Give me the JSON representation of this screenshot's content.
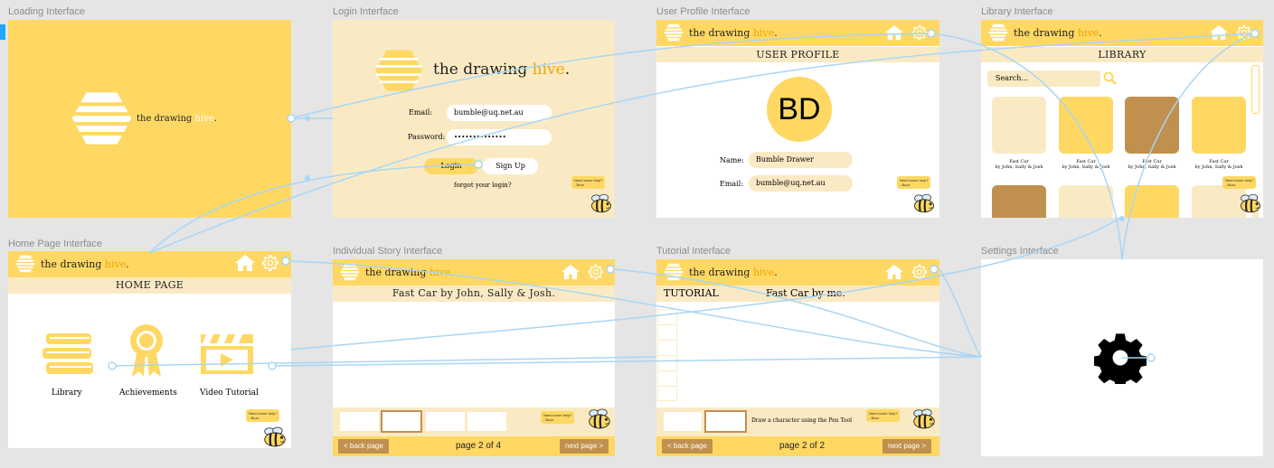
{
  "brand": {
    "prefix": "the drawing ",
    "accent": "hive",
    "suffix": "."
  },
  "colors": {
    "yellow": "#fed863",
    "cream": "#faeac4",
    "brown": "#c0904e",
    "amber": "#f0a500",
    "link": "#a9d6f5"
  },
  "help": {
    "line1": "Need some help?",
    "line2": "- Buzz"
  },
  "frames": {
    "loading": {
      "label": "Loading Interface"
    },
    "login": {
      "label": "Login Interface",
      "email_label": "Email:",
      "email_value": "bumble@uq.net.au",
      "password_label": "Password:",
      "password_value": "••••••••••••••",
      "login_button": "Login",
      "signup_button": "Sign Up",
      "forgot": "forgot your login?"
    },
    "profile": {
      "label": "User Profile Interface",
      "title": "USER PROFILE",
      "initials": "BD",
      "name_label": "Name:",
      "name_value": "Bumble Drawer",
      "email_label": "Email:",
      "email_value": "bumble@uq.net.au"
    },
    "library": {
      "label": "Library Interface",
      "title": "LIBRARY",
      "search_placeholder": "Search...",
      "book_title": "Fast Car",
      "book_authors": "by John, Sally & Josh"
    },
    "home": {
      "label": "Home Page Interface",
      "title": "HOME PAGE",
      "library": "Library",
      "achievements": "Achievements",
      "video": "Video Tutorial"
    },
    "story": {
      "label": "Individual Story Interface",
      "title": "Fast Car by John, Sally & Josh.",
      "back": "< back page",
      "page": "page 2 of 4",
      "next": "next page >"
    },
    "tutorial": {
      "label": "Tutorial Interface",
      "title_left": "TUTORIAL",
      "title_right": "Fast Car by me.",
      "instruction": "Draw a character using the Pen Tool",
      "back": "< back page",
      "page": "page 2 of 2",
      "next": "next page >"
    },
    "settings": {
      "label": "Settings Interface"
    }
  }
}
